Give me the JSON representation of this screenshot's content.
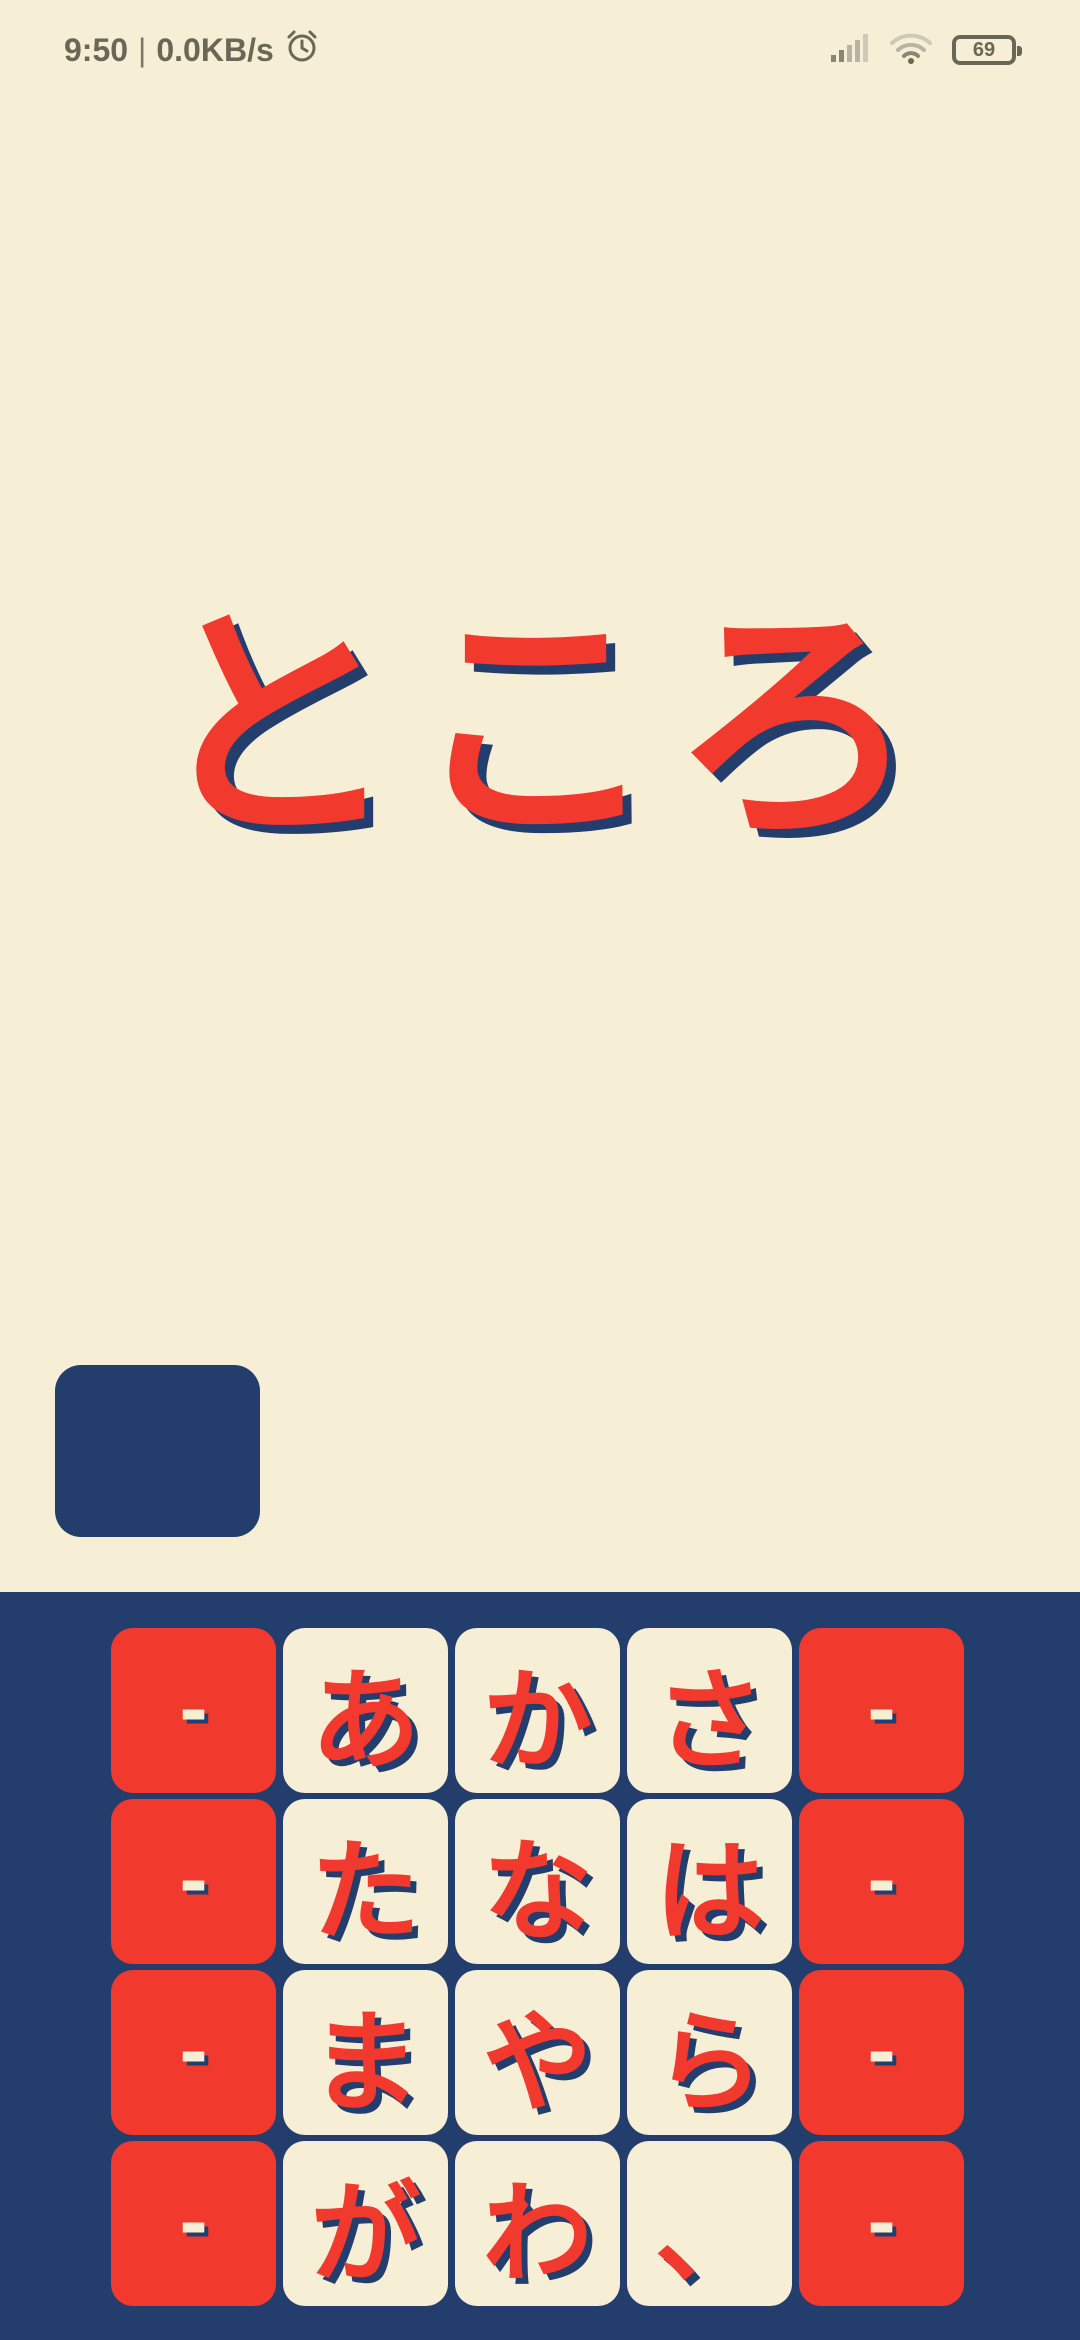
{
  "status_bar": {
    "time": "9:50",
    "separator": "|",
    "net_speed": "0.0KB/s",
    "alarm_icon": "alarm-clock-icon",
    "signal_icon": "signal-bars-icon",
    "wifi_icon": "wifi-icon",
    "battery_level": "69"
  },
  "display": {
    "word": "ところ"
  },
  "keypad": {
    "rows": [
      [
        "-",
        "あ",
        "か",
        "さ",
        "-"
      ],
      [
        "-",
        "た",
        "な",
        "は",
        "-"
      ],
      [
        "-",
        "ま",
        "や",
        "ら",
        "-"
      ],
      [
        "-",
        "が",
        "わ",
        "、",
        "-"
      ]
    ]
  },
  "colors": {
    "background": "#F6EED5",
    "accent_red": "#F2392D",
    "navy": "#233E6C"
  }
}
